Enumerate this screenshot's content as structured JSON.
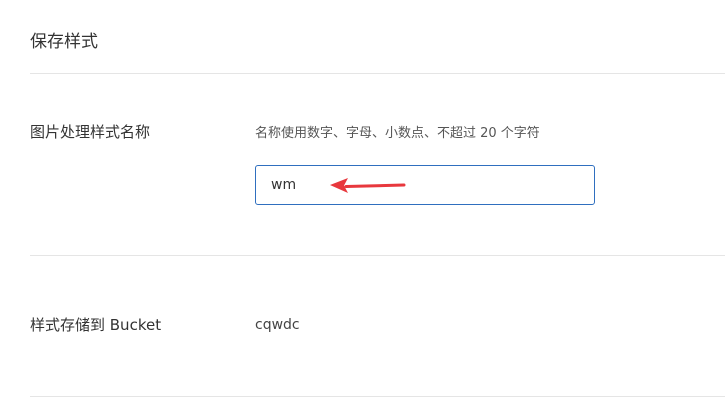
{
  "section": {
    "title": "保存样式"
  },
  "form": {
    "name_row": {
      "label": "图片处理样式名称",
      "hint": "名称使用数字、字母、小数点、不超过 20 个字符",
      "input_value": "wm"
    },
    "bucket_row": {
      "label": "样式存储到 Bucket",
      "value": "cqwdc"
    }
  },
  "annotation": {
    "icon": "red-arrow-left-icon",
    "color": "#e8383d"
  },
  "colors": {
    "input_border": "#2f6fbf",
    "divider": "#e5e5e5"
  }
}
